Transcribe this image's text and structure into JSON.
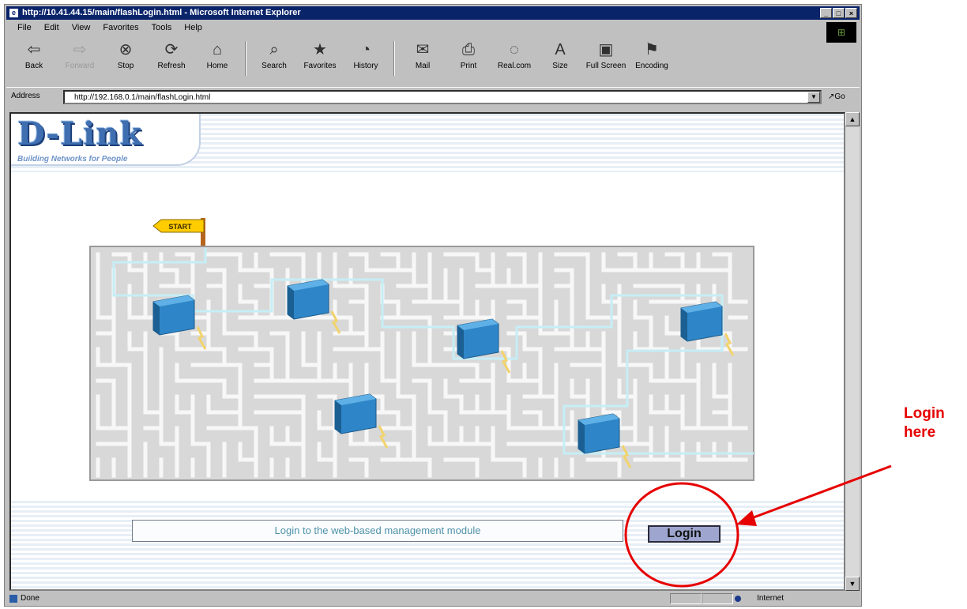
{
  "window": {
    "title": "http://10.41.44.15/main/flashLogin.html - Microsoft Internet Explorer",
    "controls": {
      "minimize": "_",
      "maximize": "□",
      "close": "×"
    }
  },
  "menu": [
    "File",
    "Edit",
    "View",
    "Favorites",
    "Tools",
    "Help"
  ],
  "toolbar": {
    "buttons": [
      {
        "label": "Back",
        "icon": "back-arrow-icon",
        "glyph": "⇦"
      },
      {
        "label": "Forward",
        "icon": "forward-arrow-icon",
        "glyph": "⇨"
      },
      {
        "label": "Stop",
        "icon": "stop-icon",
        "glyph": "⊗"
      },
      {
        "label": "Refresh",
        "icon": "refresh-icon",
        "glyph": "⟳"
      },
      {
        "label": "Home",
        "icon": "home-icon",
        "glyph": "⌂"
      },
      {
        "label": "Search",
        "icon": "search-icon",
        "glyph": "⌕"
      },
      {
        "label": "Favorites",
        "icon": "favorites-icon",
        "glyph": "★"
      },
      {
        "label": "History",
        "icon": "history-icon",
        "glyph": "◔"
      },
      {
        "label": "Mail",
        "icon": "mail-icon",
        "glyph": "✉"
      },
      {
        "label": "Print",
        "icon": "print-icon",
        "glyph": "⎙"
      },
      {
        "label": "Real.com",
        "icon": "realcom-icon",
        "glyph": "◌"
      },
      {
        "label": "Size",
        "icon": "size-icon",
        "glyph": "A"
      },
      {
        "label": "Full Screen",
        "icon": "fullscreen-icon",
        "glyph": "▣"
      },
      {
        "label": "Encoding",
        "icon": "encoding-icon",
        "glyph": "⚑"
      }
    ]
  },
  "address": {
    "label": "Address",
    "value": "http://192.168.0.1/main/flashLogin.html",
    "go_label": "Go"
  },
  "page": {
    "logo": "D-Link",
    "tagline": "Building Networks for People",
    "start_sign": "START",
    "login_prompt": "Login to the web-based management module",
    "login_button": "Login"
  },
  "status": {
    "text": "Done",
    "zone": "Internet"
  },
  "annotation": {
    "line1": "Login",
    "line2": "here",
    "color": "#e60000"
  }
}
